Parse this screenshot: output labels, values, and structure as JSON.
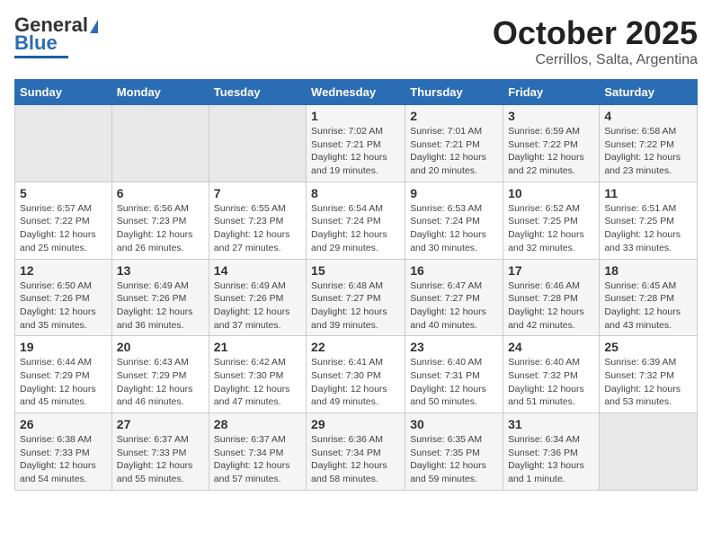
{
  "header": {
    "logo_line1": "General",
    "logo_line2": "Blue",
    "month_title": "October 2025",
    "subtitle": "Cerrillos, Salta, Argentina"
  },
  "weekdays": [
    "Sunday",
    "Monday",
    "Tuesday",
    "Wednesday",
    "Thursday",
    "Friday",
    "Saturday"
  ],
  "weeks": [
    [
      {
        "day": "",
        "empty": true
      },
      {
        "day": "",
        "empty": true
      },
      {
        "day": "",
        "empty": true
      },
      {
        "day": "1",
        "sunrise": "7:02 AM",
        "sunset": "7:21 PM",
        "daylight": "12 hours and 19 minutes."
      },
      {
        "day": "2",
        "sunrise": "7:01 AM",
        "sunset": "7:21 PM",
        "daylight": "12 hours and 20 minutes."
      },
      {
        "day": "3",
        "sunrise": "6:59 AM",
        "sunset": "7:22 PM",
        "daylight": "12 hours and 22 minutes."
      },
      {
        "day": "4",
        "sunrise": "6:58 AM",
        "sunset": "7:22 PM",
        "daylight": "12 hours and 23 minutes."
      }
    ],
    [
      {
        "day": "5",
        "sunrise": "6:57 AM",
        "sunset": "7:22 PM",
        "daylight": "12 hours and 25 minutes."
      },
      {
        "day": "6",
        "sunrise": "6:56 AM",
        "sunset": "7:23 PM",
        "daylight": "12 hours and 26 minutes."
      },
      {
        "day": "7",
        "sunrise": "6:55 AM",
        "sunset": "7:23 PM",
        "daylight": "12 hours and 27 minutes."
      },
      {
        "day": "8",
        "sunrise": "6:54 AM",
        "sunset": "7:24 PM",
        "daylight": "12 hours and 29 minutes."
      },
      {
        "day": "9",
        "sunrise": "6:53 AM",
        "sunset": "7:24 PM",
        "daylight": "12 hours and 30 minutes."
      },
      {
        "day": "10",
        "sunrise": "6:52 AM",
        "sunset": "7:25 PM",
        "daylight": "12 hours and 32 minutes."
      },
      {
        "day": "11",
        "sunrise": "6:51 AM",
        "sunset": "7:25 PM",
        "daylight": "12 hours and 33 minutes."
      }
    ],
    [
      {
        "day": "12",
        "sunrise": "6:50 AM",
        "sunset": "7:26 PM",
        "daylight": "12 hours and 35 minutes."
      },
      {
        "day": "13",
        "sunrise": "6:49 AM",
        "sunset": "7:26 PM",
        "daylight": "12 hours and 36 minutes."
      },
      {
        "day": "14",
        "sunrise": "6:49 AM",
        "sunset": "7:26 PM",
        "daylight": "12 hours and 37 minutes."
      },
      {
        "day": "15",
        "sunrise": "6:48 AM",
        "sunset": "7:27 PM",
        "daylight": "12 hours and 39 minutes."
      },
      {
        "day": "16",
        "sunrise": "6:47 AM",
        "sunset": "7:27 PM",
        "daylight": "12 hours and 40 minutes."
      },
      {
        "day": "17",
        "sunrise": "6:46 AM",
        "sunset": "7:28 PM",
        "daylight": "12 hours and 42 minutes."
      },
      {
        "day": "18",
        "sunrise": "6:45 AM",
        "sunset": "7:28 PM",
        "daylight": "12 hours and 43 minutes."
      }
    ],
    [
      {
        "day": "19",
        "sunrise": "6:44 AM",
        "sunset": "7:29 PM",
        "daylight": "12 hours and 45 minutes."
      },
      {
        "day": "20",
        "sunrise": "6:43 AM",
        "sunset": "7:29 PM",
        "daylight": "12 hours and 46 minutes."
      },
      {
        "day": "21",
        "sunrise": "6:42 AM",
        "sunset": "7:30 PM",
        "daylight": "12 hours and 47 minutes."
      },
      {
        "day": "22",
        "sunrise": "6:41 AM",
        "sunset": "7:30 PM",
        "daylight": "12 hours and 49 minutes."
      },
      {
        "day": "23",
        "sunrise": "6:40 AM",
        "sunset": "7:31 PM",
        "daylight": "12 hours and 50 minutes."
      },
      {
        "day": "24",
        "sunrise": "6:40 AM",
        "sunset": "7:32 PM",
        "daylight": "12 hours and 51 minutes."
      },
      {
        "day": "25",
        "sunrise": "6:39 AM",
        "sunset": "7:32 PM",
        "daylight": "12 hours and 53 minutes."
      }
    ],
    [
      {
        "day": "26",
        "sunrise": "6:38 AM",
        "sunset": "7:33 PM",
        "daylight": "12 hours and 54 minutes."
      },
      {
        "day": "27",
        "sunrise": "6:37 AM",
        "sunset": "7:33 PM",
        "daylight": "12 hours and 55 minutes."
      },
      {
        "day": "28",
        "sunrise": "6:37 AM",
        "sunset": "7:34 PM",
        "daylight": "12 hours and 57 minutes."
      },
      {
        "day": "29",
        "sunrise": "6:36 AM",
        "sunset": "7:34 PM",
        "daylight": "12 hours and 58 minutes."
      },
      {
        "day": "30",
        "sunrise": "6:35 AM",
        "sunset": "7:35 PM",
        "daylight": "12 hours and 59 minutes."
      },
      {
        "day": "31",
        "sunrise": "6:34 AM",
        "sunset": "7:36 PM",
        "daylight": "13 hours and 1 minute."
      },
      {
        "day": "",
        "empty": true
      }
    ]
  ]
}
